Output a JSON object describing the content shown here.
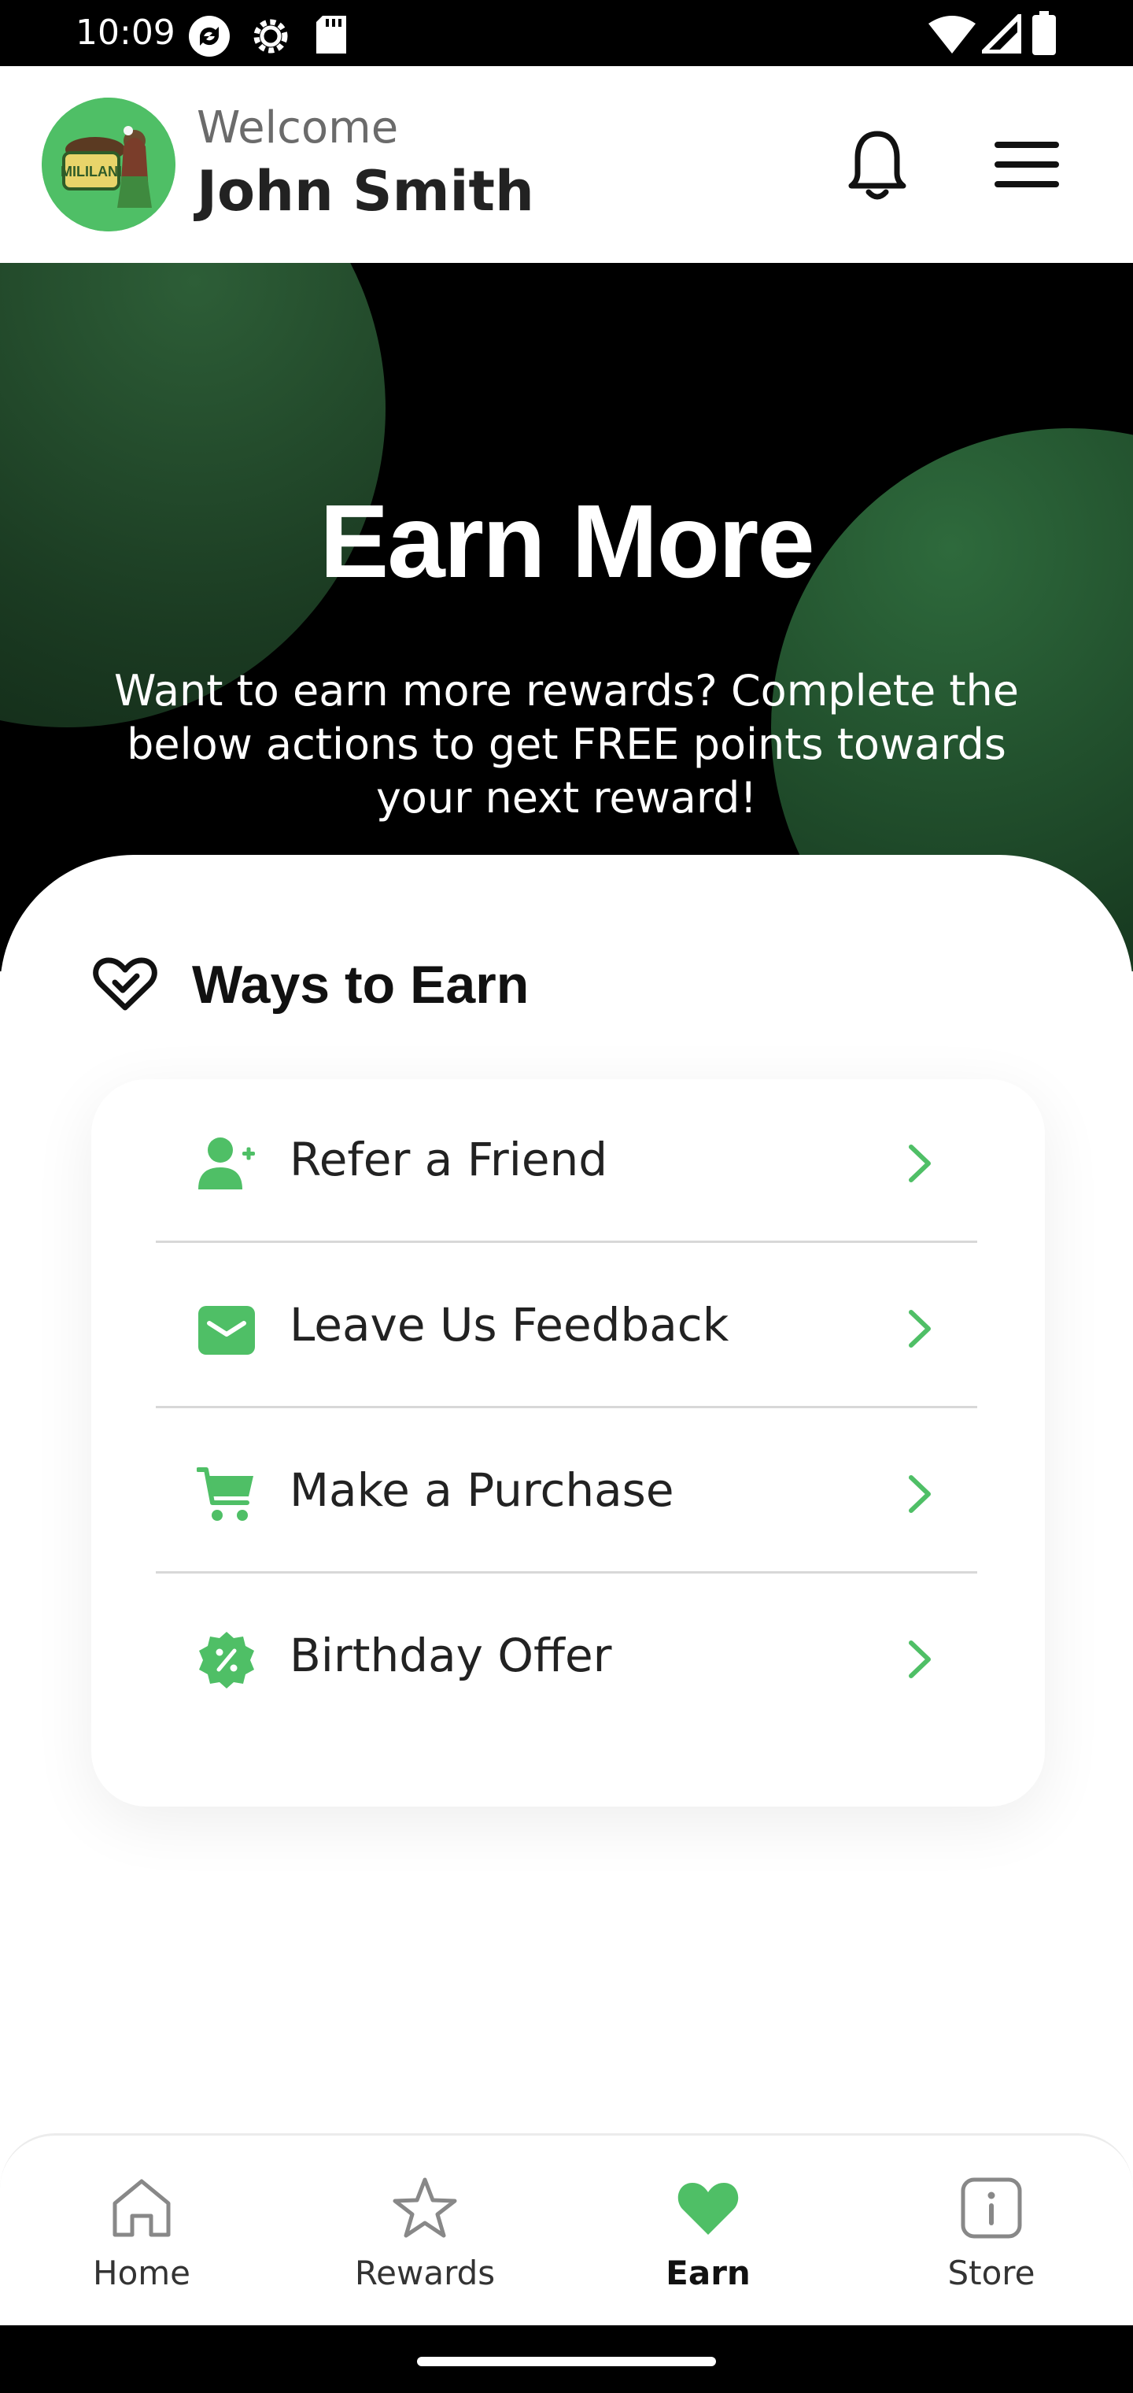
{
  "status_bar": {
    "time": "10:09"
  },
  "header": {
    "welcome": "Welcome",
    "user_name": "John Smith",
    "avatar_icon": "brand-logo",
    "notification_icon": "bell-icon",
    "menu_icon": "hamburger-menu-icon"
  },
  "hero": {
    "title": "Earn More",
    "subtitle": "Want to earn more rewards? Complete the below actions to get FREE points towards your next reward!"
  },
  "ways_to_earn": {
    "title": "Ways to Earn",
    "items": [
      {
        "label": "Refer a Friend",
        "icon": "add-user-icon"
      },
      {
        "label": "Leave Us Feedback",
        "icon": "envelope-icon"
      },
      {
        "label": "Make a Purchase",
        "icon": "cart-icon"
      },
      {
        "label": "Birthday Offer",
        "icon": "discount-badge-icon"
      }
    ]
  },
  "bottom_nav": {
    "items": [
      {
        "label": "Home",
        "icon": "home-icon",
        "active": false
      },
      {
        "label": "Rewards",
        "icon": "star-icon",
        "active": false
      },
      {
        "label": "Earn",
        "icon": "heart-icon",
        "active": true
      },
      {
        "label": "Store",
        "icon": "info-icon",
        "active": false
      }
    ]
  },
  "colors": {
    "accent": "#4fbf66",
    "hero_background": "#000000",
    "hero_circle": "#1f4a29",
    "text_primary": "#111111"
  }
}
